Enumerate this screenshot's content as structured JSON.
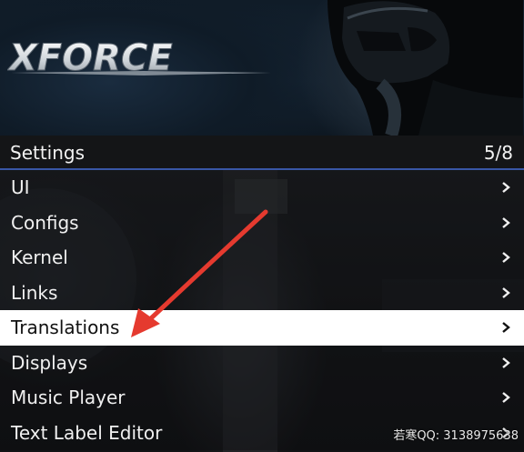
{
  "banner": {
    "logo_text": "XFORCE"
  },
  "header": {
    "title": "Settings",
    "page_counter": "5/8"
  },
  "menu": {
    "items": [
      {
        "label": "UI"
      },
      {
        "label": "Configs"
      },
      {
        "label": "Kernel"
      },
      {
        "label": "Links"
      },
      {
        "label": "Translations",
        "selected": true
      },
      {
        "label": "Displays"
      },
      {
        "label": "Music Player"
      },
      {
        "label": "Text Label Editor"
      }
    ]
  },
  "watermark": {
    "text": "若寒QQ: 3138975638"
  },
  "colors": {
    "header_underline": "#3956a6",
    "selected_bg": "#ffffff",
    "annotation_arrow": "#e53a2f"
  },
  "icons": {
    "item_chevron": "chevron-right-icon",
    "annotation": "red-arrow-icon"
  }
}
